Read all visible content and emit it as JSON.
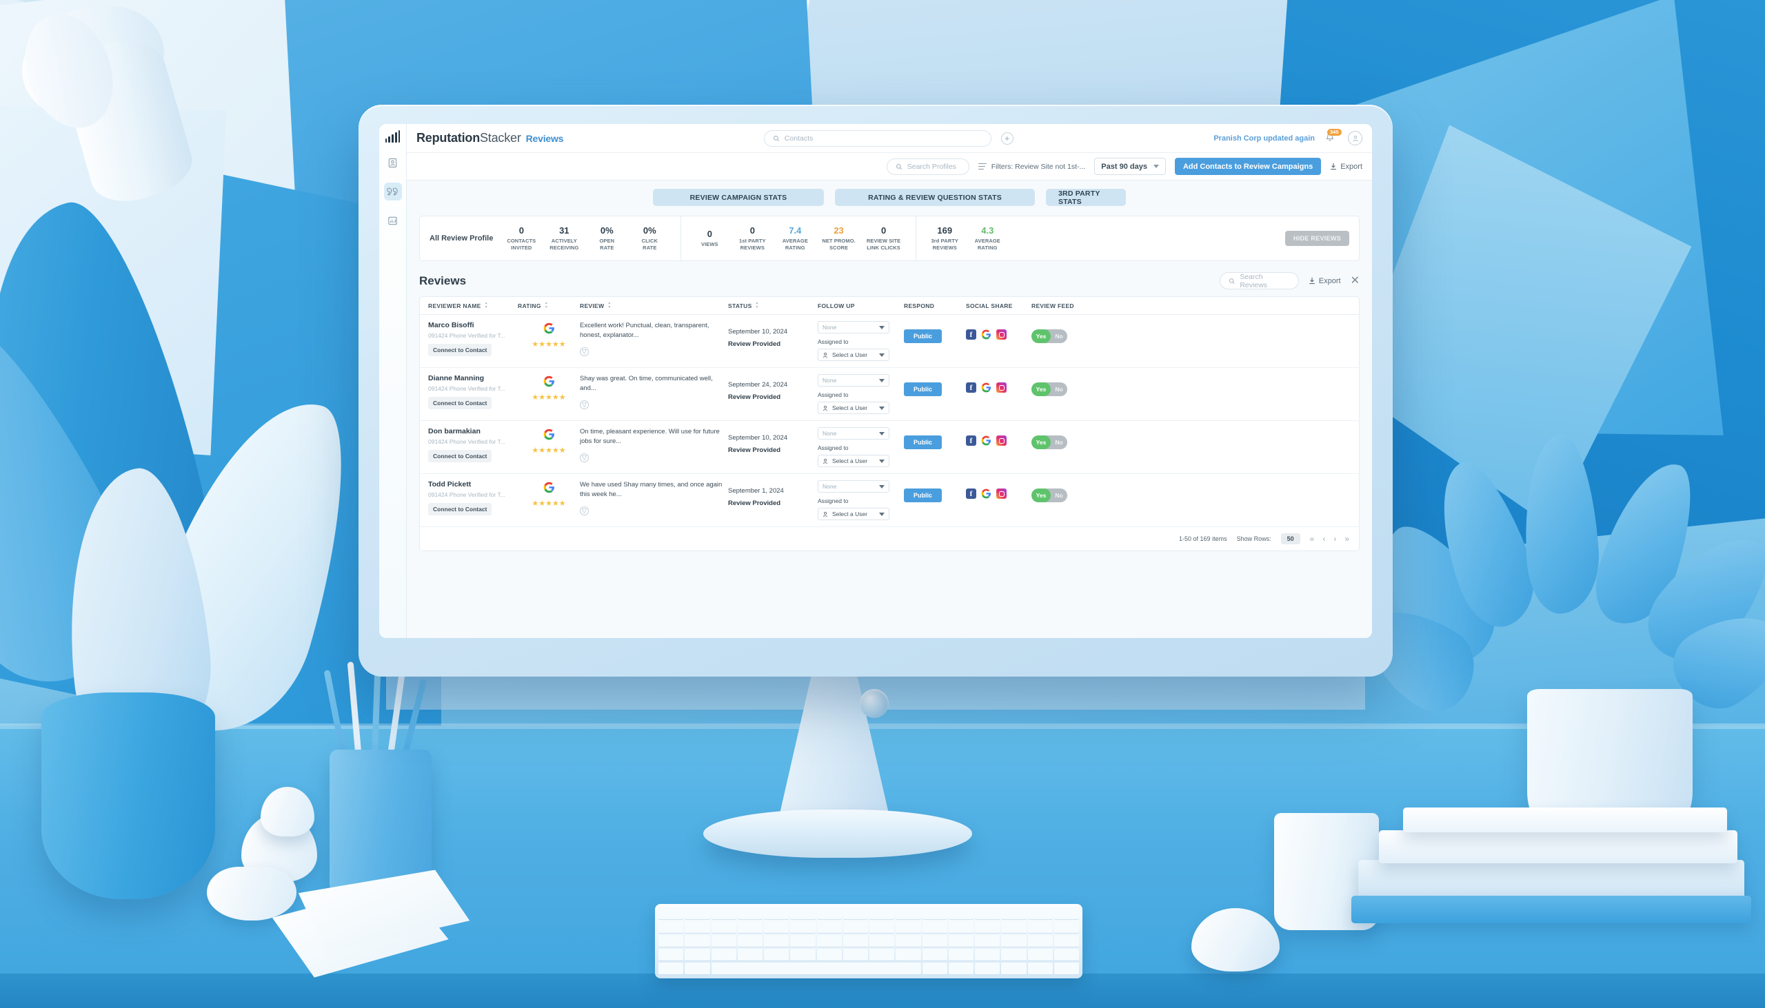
{
  "rail": {
    "logo_icon": "bar-chart-logo-icon",
    "items": [
      {
        "icon": "contacts-icon",
        "active": false
      },
      {
        "icon": "quotes-reviews-icon",
        "active": true
      },
      {
        "icon": "analytics-icon",
        "active": false
      }
    ]
  },
  "topbar": {
    "brand_bold": "Reputation",
    "brand_light": "Stacker",
    "brand_section": "Reviews",
    "contacts_search_placeholder": "Contacts",
    "add_icon": "plus-circle-icon",
    "notice": "Pranish Corp updated again",
    "notification_count": "345",
    "bell_icon": "bell-icon",
    "avatar_icon": "user-avatar-icon"
  },
  "filterbar": {
    "profiles_search_placeholder": "Search Profiles",
    "filters_label": "Filters: Review Site not 1st-...",
    "date_range": "Past 90 days",
    "primary_button": "Add Contacts to Review Campaigns",
    "export_label": "Export"
  },
  "tabs": [
    {
      "label": "REVIEW CAMPAIGN STATS",
      "width": "w1"
    },
    {
      "label": "RATING & REVIEW QUESTION STATS",
      "width": "w2"
    },
    {
      "label": "3RD PARTY STATS",
      "width": "w3"
    }
  ],
  "stats": {
    "profile_label": "All Review Profile",
    "hide_button": "HIDE REVIEWS",
    "group1": [
      {
        "value": "0",
        "label": "CONTACTS\nINVITED",
        "color": ""
      },
      {
        "value": "31",
        "label": "ACTIVELY\nRECEIVING",
        "color": ""
      },
      {
        "value": "0%",
        "label": "OPEN\nRATE",
        "color": ""
      },
      {
        "value": "0%",
        "label": "CLICK\nRATE",
        "color": ""
      }
    ],
    "group2": [
      {
        "value": "0",
        "label": "VIEWS",
        "color": ""
      },
      {
        "value": "0",
        "label": "1st PARTY\nREVIEWS",
        "color": ""
      },
      {
        "value": "7.4",
        "label": "AVERAGE\nRATING",
        "color": "blue"
      },
      {
        "value": "23",
        "label": "NET PROMO.\nSCORE",
        "color": "orange"
      },
      {
        "value": "0",
        "label": "REVIEW SITE\nLINK CLICKS",
        "color": ""
      }
    ],
    "group3": [
      {
        "value": "169",
        "label": "3rd PARTY\nREVIEWS",
        "color": ""
      },
      {
        "value": "4.3",
        "label": "AVERAGE\nRATING",
        "color": "green"
      }
    ]
  },
  "reviews_panel": {
    "title": "Reviews",
    "search_placeholder": "Search Reviews",
    "export_label": "Export",
    "close_icon": "close-x-icon"
  },
  "table": {
    "columns": [
      {
        "label": "REVIEWER NAME",
        "cls": "c-name",
        "sortable": true
      },
      {
        "label": "RATING",
        "cls": "c-rating",
        "sortable": true
      },
      {
        "label": "REVIEW",
        "cls": "c-review",
        "sortable": true
      },
      {
        "label": "STATUS",
        "cls": "c-status",
        "sortable": true
      },
      {
        "label": "FOLLOW UP",
        "cls": "c-follow",
        "sortable": false
      },
      {
        "label": "RESPOND",
        "cls": "c-respond",
        "sortable": false
      },
      {
        "label": "SOCIAL SHARE",
        "cls": "c-social",
        "sortable": false
      },
      {
        "label": "REVIEW FEED",
        "cls": "c-feed",
        "sortable": false
      }
    ],
    "row_defaults": {
      "connect_label": "Connect to Contact",
      "source_icon": "google-g-icon",
      "stars": "★★★★★",
      "expand_icon": "expand-circle-icon",
      "followup_value": "None",
      "assigned_label": "Assigned to",
      "assign_value": "Select a User",
      "assign_icon": "user-icon",
      "respond_label": "Public",
      "social_icons": [
        "facebook-icon",
        "google-icon",
        "instagram-icon"
      ],
      "feed_yes": "Yes",
      "feed_no": "No"
    },
    "rows": [
      {
        "name": "Marco Bisoffi",
        "sub": "091424 Phone Verified for T...",
        "review": "Excellent work! Punctual, clean, transparent, honest, explanator...",
        "date": "September 10, 2024",
        "state": "Review Provided"
      },
      {
        "name": "Dianne Manning",
        "sub": "091424 Phone Verified for T...",
        "review": "Shay was great. On time, communicated well, and...",
        "date": "September 24, 2024",
        "state": "Review Provided"
      },
      {
        "name": "Don barmakian",
        "sub": "091424 Phone Verified for T...",
        "review": "On time, pleasant experience. Will use for future jobs for sure...",
        "date": "September 10, 2024",
        "state": "Review Provided"
      },
      {
        "name": "Todd Pickett",
        "sub": "091424 Phone Verified for T...",
        "review": "We have used Shay many times, and once again this week he...",
        "date": "September 1, 2024",
        "state": "Review Provided"
      }
    ],
    "footer": {
      "items_range": "1-50 of 169 items",
      "show_rows_label": "Show Rows:",
      "rows_value": "50",
      "first_icon": "«",
      "prev_icon": "‹",
      "next_icon": "›",
      "last_icon": "»"
    }
  },
  "colors": {
    "accent_blue": "#4a9ede",
    "tab_blue": "#cfe4f2",
    "star_yellow": "#f5c243",
    "toggle_green": "#5fc36b",
    "badge_orange": "#f0a13c",
    "stat_green": "#63bb6c",
    "stat_orange": "#eaa03c"
  }
}
